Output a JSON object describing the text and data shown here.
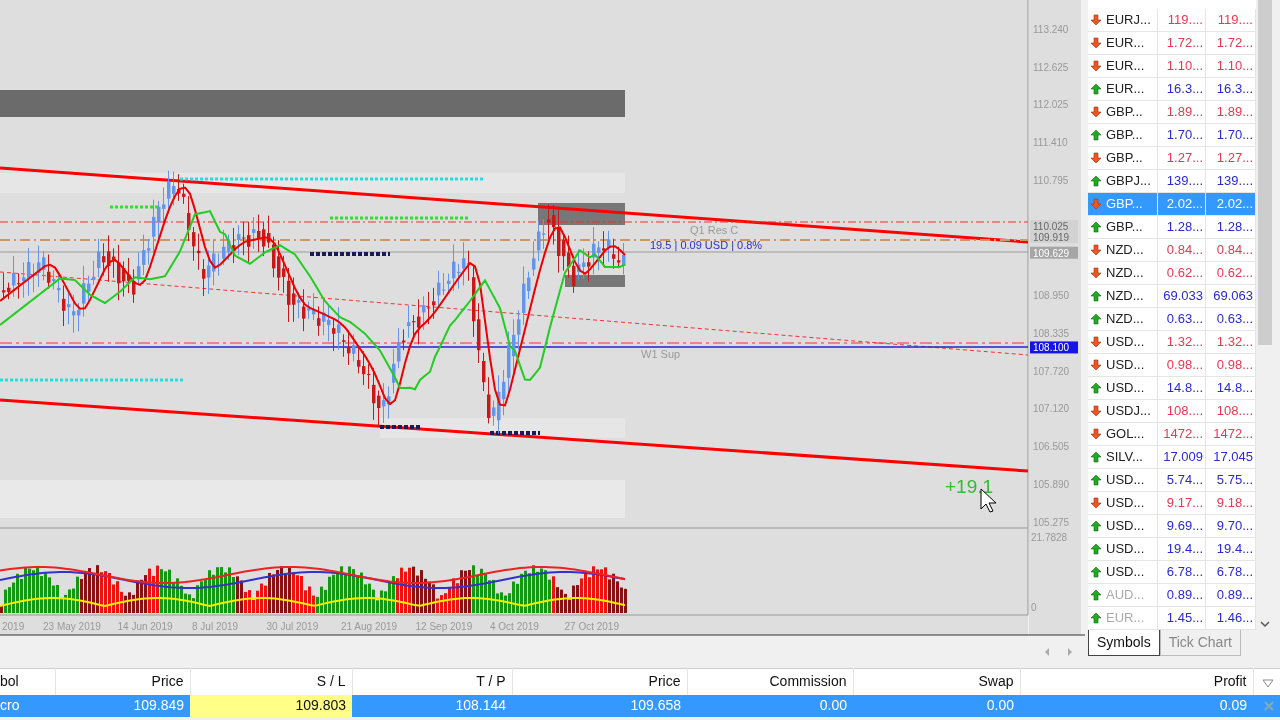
{
  "chart": {
    "price_axis": [
      "113.240",
      "112.625",
      "112.025",
      "111.410",
      "110.795",
      "108.950",
      "108.335",
      "107.720",
      "107.120",
      "106.505",
      "105.890",
      "105.275"
    ],
    "price_tags": [
      {
        "text": "110.025",
        "kind": "faint"
      },
      {
        "text": "109.919",
        "kind": "faint"
      },
      {
        "text": "109.629",
        "kind": "grey"
      },
      {
        "text": "108.100",
        "kind": "blue"
      }
    ],
    "indicator_axis": [
      "21.7828",
      "0"
    ],
    "date_axis": [
      "2019",
      "23 May 2019",
      "14 Jun 2019",
      "8 Jul 2019",
      "30 Jul 2019",
      "21 Aug 2019",
      "12 Sep 2019",
      "4 Oct 2019",
      "27 Oct 2019"
    ],
    "level_labels": [
      "Q1 Res C",
      "W1 Sup"
    ],
    "trade_label": "19.5 | 0.09 USD | 0.8%",
    "profit_label": "+19.1"
  },
  "market_watch": {
    "rows": [
      {
        "symbol": "EURJ...",
        "bid": "119....",
        "ask": "119....",
        "rising": false,
        "selected": false,
        "dimmed": false
      },
      {
        "symbol": "EUR...",
        "bid": "1.72...",
        "ask": "1.72...",
        "rising": false,
        "selected": false,
        "dimmed": false
      },
      {
        "symbol": "EUR...",
        "bid": "1.10...",
        "ask": "1.10...",
        "rising": false,
        "selected": false,
        "dimmed": false
      },
      {
        "symbol": "EUR...",
        "bid": "16.3...",
        "ask": "16.3...",
        "rising": true,
        "selected": false,
        "dimmed": false
      },
      {
        "symbol": "GBP...",
        "bid": "1.89...",
        "ask": "1.89...",
        "rising": false,
        "selected": false,
        "dimmed": false
      },
      {
        "symbol": "GBP...",
        "bid": "1.70...",
        "ask": "1.70...",
        "rising": true,
        "selected": false,
        "dimmed": false
      },
      {
        "symbol": "GBP...",
        "bid": "1.27...",
        "ask": "1.27...",
        "rising": false,
        "selected": false,
        "dimmed": false
      },
      {
        "symbol": "GBPJ...",
        "bid": "139....",
        "ask": "139....",
        "rising": true,
        "selected": false,
        "dimmed": false
      },
      {
        "symbol": "GBP...",
        "bid": "2.02...",
        "ask": "2.02...",
        "rising": false,
        "selected": true,
        "dimmed": false
      },
      {
        "symbol": "GBP...",
        "bid": "1.28...",
        "ask": "1.28...",
        "rising": true,
        "selected": false,
        "dimmed": false
      },
      {
        "symbol": "NZD...",
        "bid": "0.84...",
        "ask": "0.84...",
        "rising": false,
        "selected": false,
        "dimmed": false
      },
      {
        "symbol": "NZD...",
        "bid": "0.62...",
        "ask": "0.62...",
        "rising": false,
        "selected": false,
        "dimmed": false
      },
      {
        "symbol": "NZD...",
        "bid": "69.033",
        "ask": "69.063",
        "rising": true,
        "selected": false,
        "dimmed": false
      },
      {
        "symbol": "NZD...",
        "bid": "0.63...",
        "ask": "0.63...",
        "rising": true,
        "selected": false,
        "dimmed": false
      },
      {
        "symbol": "USD...",
        "bid": "1.32...",
        "ask": "1.32...",
        "rising": false,
        "selected": false,
        "dimmed": false
      },
      {
        "symbol": "USD...",
        "bid": "0.98...",
        "ask": "0.98...",
        "rising": false,
        "selected": false,
        "dimmed": false
      },
      {
        "symbol": "USD...",
        "bid": "14.8...",
        "ask": "14.8...",
        "rising": true,
        "selected": false,
        "dimmed": false
      },
      {
        "symbol": "USDJ...",
        "bid": "108....",
        "ask": "108....",
        "rising": false,
        "selected": false,
        "dimmed": false
      },
      {
        "symbol": "GOL...",
        "bid": "1472...",
        "ask": "1472...",
        "rising": false,
        "selected": false,
        "dimmed": false
      },
      {
        "symbol": "SILV...",
        "bid": "17.009",
        "ask": "17.045",
        "rising": true,
        "selected": false,
        "dimmed": false
      },
      {
        "symbol": "USD...",
        "bid": "5.74...",
        "ask": "5.75...",
        "rising": true,
        "selected": false,
        "dimmed": false
      },
      {
        "symbol": "USD...",
        "bid": "9.17...",
        "ask": "9.18...",
        "rising": false,
        "selected": false,
        "dimmed": false
      },
      {
        "symbol": "USD...",
        "bid": "9.69...",
        "ask": "9.70...",
        "rising": true,
        "selected": false,
        "dimmed": false
      },
      {
        "symbol": "USD...",
        "bid": "19.4...",
        "ask": "19.4...",
        "rising": true,
        "selected": false,
        "dimmed": false
      },
      {
        "symbol": "USD...",
        "bid": "6.78...",
        "ask": "6.78...",
        "rising": true,
        "selected": false,
        "dimmed": false
      },
      {
        "symbol": "AUD...",
        "bid": "0.89...",
        "ask": "0.89...",
        "rising": true,
        "selected": false,
        "dimmed": true
      },
      {
        "symbol": "EUR...",
        "bid": "1.45...",
        "ask": "1.46...",
        "rising": true,
        "selected": false,
        "dimmed": true
      }
    ],
    "tabs": [
      {
        "label": "Symbols",
        "selected": true
      },
      {
        "label": "Tick Chart",
        "selected": false
      }
    ]
  },
  "trades": {
    "columns": [
      "bol",
      "Price",
      "S / L",
      "T / P",
      "Price",
      "Commission",
      "Swap",
      "Profit"
    ],
    "rows": [
      {
        "selected": true,
        "cells": [
          {
            "text": "cro",
            "highlighted": false
          },
          {
            "text": "109.849",
            "highlighted": false
          },
          {
            "text": "109.803",
            "highlighted": true
          },
          {
            "text": "108.144",
            "highlighted": false
          },
          {
            "text": "109.658",
            "highlighted": false
          },
          {
            "text": "0.00",
            "highlighted": false
          },
          {
            "text": "0.00",
            "highlighted": false
          },
          {
            "text": "0.09",
            "highlighted": false
          }
        ]
      }
    ]
  }
}
